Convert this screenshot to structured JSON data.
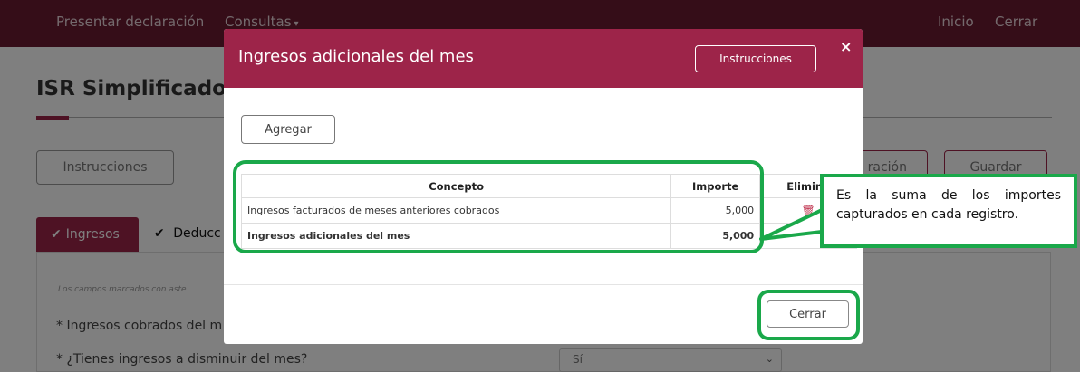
{
  "navbar": {
    "presentar": "Presentar declaración",
    "consultas": "Consultas",
    "inicio": "Inicio",
    "cerrar": "Cerrar"
  },
  "page": {
    "title": "ISR Simplificado",
    "instrucciones_btn": "Instrucciones",
    "declaracion_btn": "ración",
    "guardar_btn": "Guardar",
    "tab_ingresos": "Ingresos",
    "tab_deducciones": "Deducc",
    "note": "Los campos marcados con aste",
    "field_ingresos_cobrados": "* Ingresos cobrados del m",
    "field_disminuir": "* ¿Tienes ingresos a disminuir del mes?",
    "select_value": "Sí"
  },
  "modal": {
    "title": "Ingresos adicionales del mes",
    "instrucciones_btn": "Instrucciones",
    "close_symbol": "×",
    "agregar_btn": "Agregar",
    "table": {
      "headers": [
        "Concepto",
        "Importe",
        "Elimina"
      ],
      "rows": [
        {
          "concepto": "Ingresos facturados de meses anteriores cobrados",
          "importe": "5,000"
        }
      ],
      "total": {
        "concepto": "Ingresos adicionales del mes",
        "importe": "5,000"
      }
    },
    "cerrar_btn": "Cerrar"
  },
  "callout": {
    "text": "Es la suma de los importes capturados en cada registro."
  },
  "colors": {
    "brand": "#9d2449",
    "navbar": "#6b1a31",
    "highlight": "#1aa84a"
  }
}
